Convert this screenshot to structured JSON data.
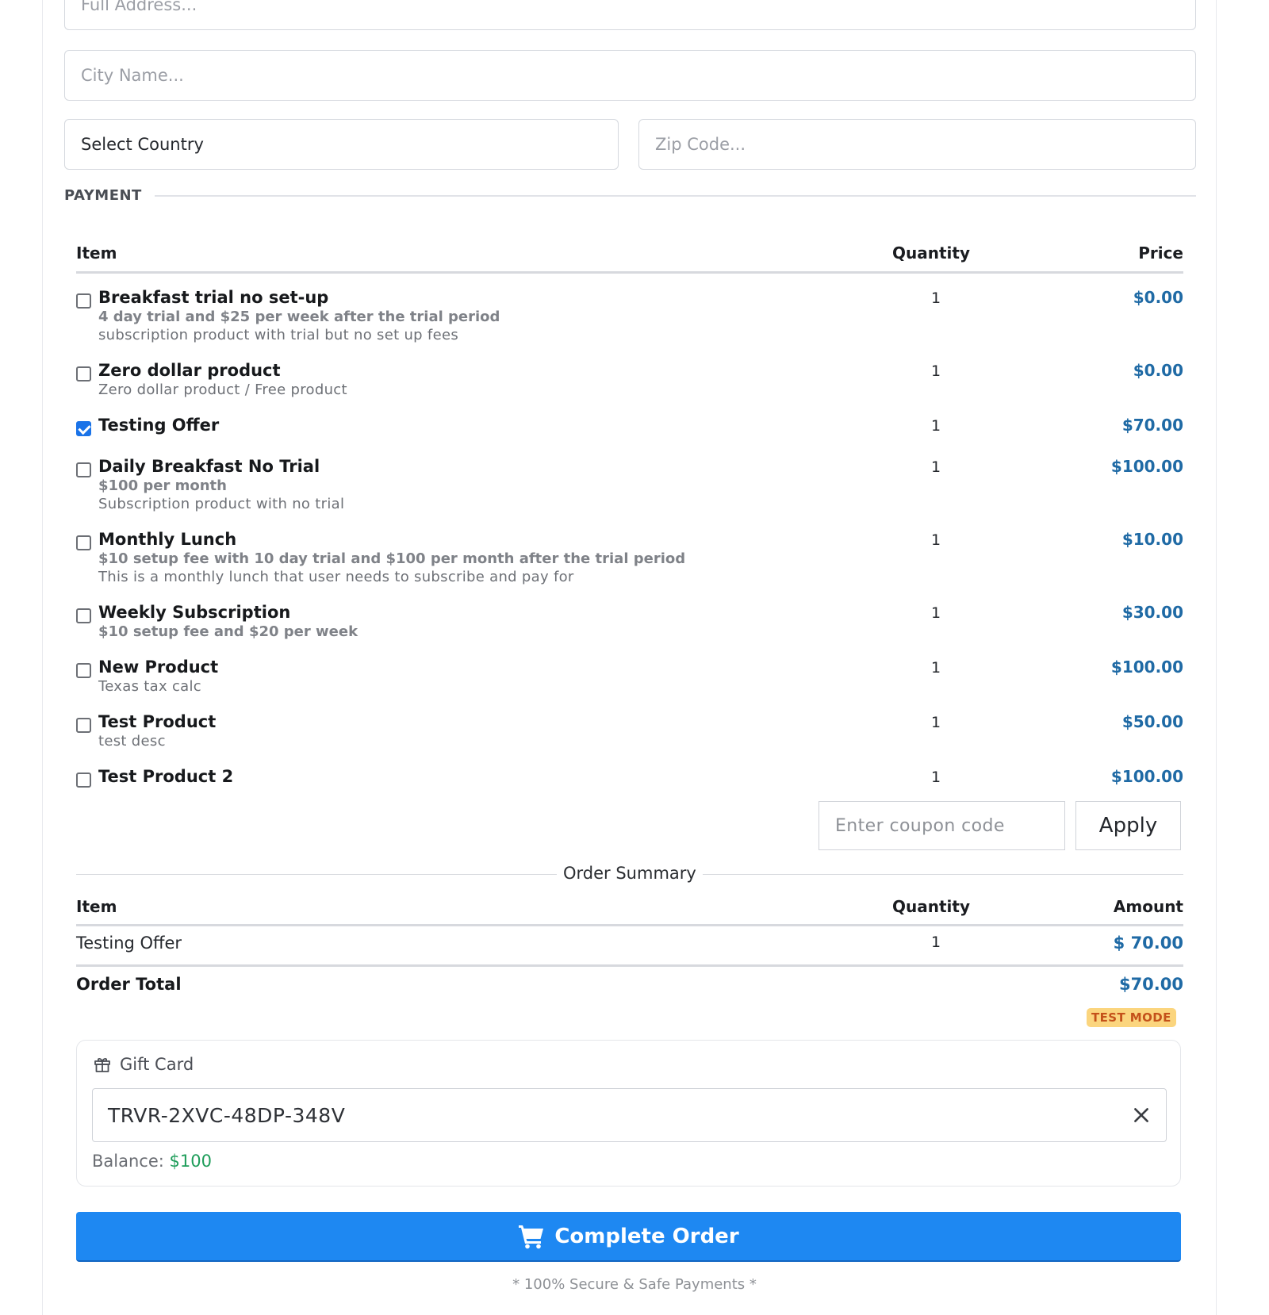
{
  "address": {
    "full_address_placeholder": "Full Address...",
    "city_placeholder": "City Name...",
    "country_value": "Select Country",
    "zip_placeholder": "Zip Code..."
  },
  "payment": {
    "section_label": "PAYMENT",
    "headers": {
      "item": "Item",
      "quantity": "Quantity",
      "price": "Price"
    },
    "products": [
      {
        "name": "Breakfast trial no set-up",
        "terms": "4 day trial and $25 per week after the trial period",
        "description": "subscription product with trial but no set up fees",
        "quantity": "1",
        "price": "$0.00",
        "checked": false
      },
      {
        "name": "Zero dollar product",
        "terms": "",
        "description": "Zero dollar product / Free product",
        "quantity": "1",
        "price": "$0.00",
        "checked": false
      },
      {
        "name": "Testing Offer",
        "terms": "",
        "description": "",
        "quantity": "1",
        "price": "$70.00",
        "checked": true
      },
      {
        "name": "Daily Breakfast No Trial",
        "terms": "$100 per month",
        "description": "Subscription product with no trial",
        "quantity": "1",
        "price": "$100.00",
        "checked": false
      },
      {
        "name": "Monthly Lunch",
        "terms": "$10 setup fee with 10 day trial and $100 per month after the trial period",
        "description": "This is a monthly lunch that user needs to subscribe and pay for",
        "quantity": "1",
        "price": "$10.00",
        "checked": false
      },
      {
        "name": "Weekly Subscription",
        "terms": "$10 setup fee and $20 per week",
        "description": "",
        "quantity": "1",
        "price": "$30.00",
        "checked": false
      },
      {
        "name": "New Product",
        "terms": "",
        "description": "Texas tax calc",
        "quantity": "1",
        "price": "$100.00",
        "checked": false
      },
      {
        "name": "Test Product",
        "terms": "",
        "description": "test desc",
        "quantity": "1",
        "price": "$50.00",
        "checked": false
      },
      {
        "name": "Test Product 2",
        "terms": "",
        "description": "",
        "quantity": "1",
        "price": "$100.00",
        "checked": false
      }
    ],
    "coupon_placeholder": "Enter coupon code",
    "apply_label": "Apply"
  },
  "order_summary": {
    "title": "Order Summary",
    "headers": {
      "item": "Item",
      "quantity": "Quantity",
      "amount": "Amount"
    },
    "lines": [
      {
        "item": "Testing Offer",
        "quantity": "1",
        "amount": "$ 70.00"
      }
    ],
    "total_label": "Order Total",
    "total_value": "$70.00",
    "badge": "TEST MODE"
  },
  "gift_card": {
    "label": "Gift Card",
    "code": "TRVR-2XVC-48DP-348V",
    "balance_label": "Balance: ",
    "balance_value": "$100"
  },
  "complete_label": "Complete Order",
  "secure_note": "* 100% Secure & Safe Payments *",
  "colors": {
    "accent": "#1e88f2",
    "price": "#1f6aa5",
    "balance": "#1e9d5a",
    "badge_bg": "#fbd57e",
    "badge_text": "#c4511a"
  },
  "icons": {
    "gift": "gift-icon",
    "clear": "close-icon",
    "cart": "cart-icon"
  }
}
